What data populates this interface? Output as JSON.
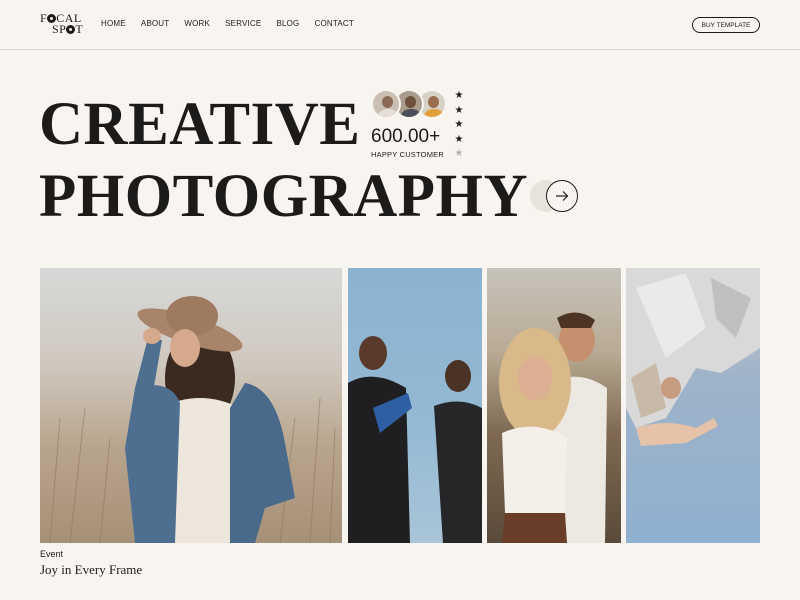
{
  "brand": {
    "logo_line1": "F",
    "logo_line1b": "CAL",
    "logo_line2": "SP",
    "logo_line2b": "T"
  },
  "nav": {
    "items": [
      {
        "label": "HOME"
      },
      {
        "label": "ABOUT"
      },
      {
        "label": "WORK"
      },
      {
        "label": "SERVICE"
      },
      {
        "label": "BLOG"
      },
      {
        "label": "CONTACT"
      }
    ],
    "cta_label": "BUY TEMPLATE"
  },
  "hero": {
    "line1": "CREATIVE",
    "line2": "PHOTOGRAPHY",
    "stat_value": "600.00+",
    "stat_label": "HAPPY CUSTOMER",
    "rating": {
      "filled": 4,
      "total": 5
    }
  },
  "gallery": {
    "photos": [
      {
        "icon": "woman-in-hat-photo"
      },
      {
        "icon": "men-streetwear-photo"
      },
      {
        "icon": "couple-portrait-photo"
      },
      {
        "icon": "woman-reflection-photo"
      }
    ],
    "featured": {
      "category": "Event",
      "title": "Joy in Every Frame"
    }
  },
  "colors": {
    "background": "#f8f5f1",
    "text": "#1c1b19",
    "star_filled": "#1c1b19",
    "star_empty": "#b5b1ab"
  }
}
